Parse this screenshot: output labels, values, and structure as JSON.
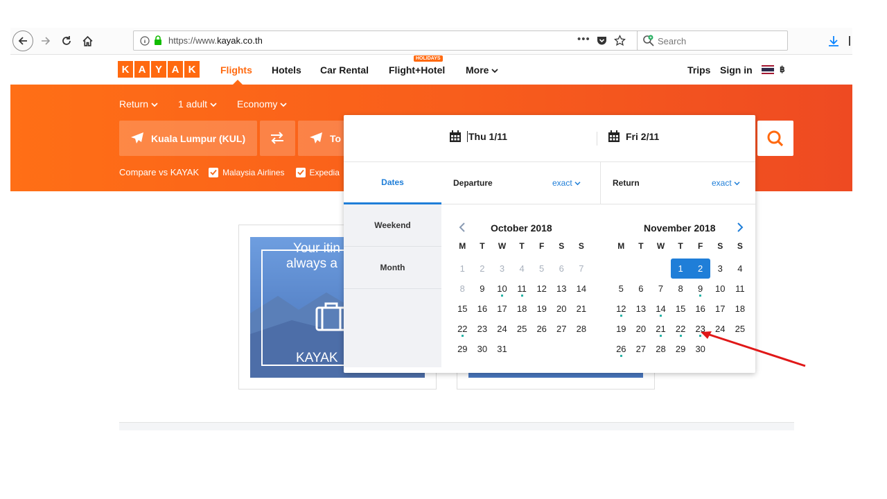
{
  "browser": {
    "url_prefix": "https://www.",
    "url_domain": "kayak.co.th",
    "search_placeholder": "Search"
  },
  "header": {
    "logo_letters": [
      "K",
      "A",
      "Y",
      "A",
      "K"
    ],
    "nav": {
      "flights": "Flights",
      "hotels": "Hotels",
      "car_rental": "Car Rental",
      "flight_hotel": "Flight+Hotel",
      "holidays_badge": "HOLIDAYS",
      "more": "More"
    },
    "trips": "Trips",
    "sign_in": "Sign in",
    "currency": "฿"
  },
  "search": {
    "trip_type": "Return",
    "travelers": "1 adult",
    "cabin": "Economy",
    "origin": "Kuala Lumpur (KUL)",
    "destination": "To",
    "compare_label": "Compare vs KAYAK",
    "compare_options": [
      "Malaysia Airlines",
      "Expedia"
    ]
  },
  "promo": {
    "line1": "Your itin",
    "line2": "always a",
    "footer": "KAYAK"
  },
  "datepicker": {
    "depart_date": "Thu 1/11",
    "return_date": "Fri 2/11",
    "tabs": [
      "Dates",
      "Weekend",
      "Month"
    ],
    "departure_label": "Departure",
    "return_label": "Return",
    "flex_option": "exact",
    "weekdays": [
      "M",
      "T",
      "W",
      "T",
      "F",
      "S",
      "S"
    ],
    "months": [
      {
        "title": "October 2018",
        "weeks": [
          [
            {
              "d": "1",
              "m": 1
            },
            {
              "d": "2",
              "m": 1
            },
            {
              "d": "3",
              "m": 1
            },
            {
              "d": "4",
              "m": 1
            },
            {
              "d": "5",
              "m": 1
            },
            {
              "d": "6",
              "m": 1
            },
            {
              "d": "7",
              "m": 1
            }
          ],
          [
            {
              "d": "8",
              "m": 1
            },
            {
              "d": "9"
            },
            {
              "d": "10",
              "dot": 1
            },
            {
              "d": "11",
              "dot": 1
            },
            {
              "d": "12"
            },
            {
              "d": "13"
            },
            {
              "d": "14"
            }
          ],
          [
            {
              "d": "15"
            },
            {
              "d": "16"
            },
            {
              "d": "17"
            },
            {
              "d": "18"
            },
            {
              "d": "19"
            },
            {
              "d": "20"
            },
            {
              "d": "21"
            }
          ],
          [
            {
              "d": "22",
              "dot": 1
            },
            {
              "d": "23"
            },
            {
              "d": "24"
            },
            {
              "d": "25"
            },
            {
              "d": "26"
            },
            {
              "d": "27"
            },
            {
              "d": "28"
            }
          ],
          [
            {
              "d": "29"
            },
            {
              "d": "30"
            },
            {
              "d": "31"
            },
            {
              "d": ""
            },
            {
              "d": ""
            },
            {
              "d": ""
            },
            {
              "d": ""
            }
          ]
        ]
      },
      {
        "title": "November 2018",
        "weeks": [
          [
            {
              "d": ""
            },
            {
              "d": ""
            },
            {
              "d": ""
            },
            {
              "d": "1",
              "sel": "first"
            },
            {
              "d": "2",
              "sel": "last"
            },
            {
              "d": "3"
            },
            {
              "d": "4"
            }
          ],
          [
            {
              "d": "5"
            },
            {
              "d": "6"
            },
            {
              "d": "7"
            },
            {
              "d": "8"
            },
            {
              "d": "9",
              "dot": 1
            },
            {
              "d": "10"
            },
            {
              "d": "11"
            }
          ],
          [
            {
              "d": "12",
              "dot": 1
            },
            {
              "d": "13"
            },
            {
              "d": "14",
              "dot": 1
            },
            {
              "d": "15"
            },
            {
              "d": "16"
            },
            {
              "d": "17"
            },
            {
              "d": "18"
            }
          ],
          [
            {
              "d": "19"
            },
            {
              "d": "20"
            },
            {
              "d": "21",
              "dot": 1
            },
            {
              "d": "22",
              "dot": 1
            },
            {
              "d": "23",
              "dot": 1
            },
            {
              "d": "24"
            },
            {
              "d": "25"
            }
          ],
          [
            {
              "d": "26",
              "dot": 1
            },
            {
              "d": "27"
            },
            {
              "d": "28"
            },
            {
              "d": "29"
            },
            {
              "d": "30"
            },
            {
              "d": ""
            },
            {
              "d": ""
            }
          ]
        ]
      }
    ]
  },
  "colors": {
    "brand_orange": "#ff690f",
    "accent_blue": "#1f7ed8",
    "deal_dot": "#2ab3a6",
    "annotation_red": "#e01818"
  }
}
